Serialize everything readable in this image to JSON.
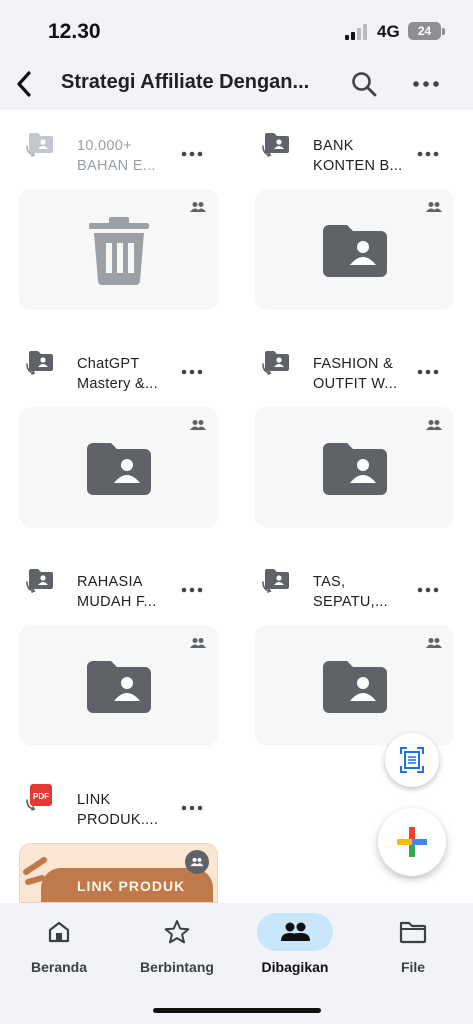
{
  "status_bar": {
    "time": "12.30",
    "network": "4G",
    "battery": "24"
  },
  "header": {
    "title": "Strategi Affiliate Dengan...",
    "back_icon": "chevron-left-icon",
    "search_icon": "search-icon",
    "more_icon": "more-horiz-icon"
  },
  "folders": [
    {
      "line1": "10.000+",
      "line2": "BAHAN E...",
      "dimmed": true,
      "thumbnail": "trash-icon"
    },
    {
      "line1": "BANK",
      "line2": "KONTEN B...",
      "dimmed": false,
      "thumbnail": "shared-folder-icon"
    },
    {
      "line1": "ChatGPT",
      "line2": "Mastery &...",
      "dimmed": false,
      "thumbnail": "shared-folder-icon"
    },
    {
      "line1": "FASHION &",
      "line2": "OUTFIT W...",
      "dimmed": false,
      "thumbnail": "shared-folder-icon"
    },
    {
      "line1": "RAHASIA",
      "line2": "MUDAH F...",
      "dimmed": false,
      "thumbnail": "shared-folder-icon"
    },
    {
      "line1": "TAS,",
      "line2": "SEPATU,...",
      "dimmed": false,
      "thumbnail": "shared-folder-icon"
    }
  ],
  "files": [
    {
      "line1": "LINK",
      "line2": "PRODUK....",
      "type_icon": "pdf-icon",
      "type_label": "PDF",
      "thumbnail_text": "LINK PRODUK"
    }
  ],
  "fabs": {
    "scan_icon": "document-scan-icon",
    "new_icon": "plus-icon"
  },
  "bottom_nav": [
    {
      "label": "Beranda",
      "icon": "home-icon",
      "active": false
    },
    {
      "label": "Berbintang",
      "icon": "star-icon",
      "active": false
    },
    {
      "label": "Dibagikan",
      "icon": "people-icon",
      "active": true
    },
    {
      "label": "File",
      "icon": "folder-icon",
      "active": false
    }
  ],
  "colors": {
    "accent": "#1a73e8",
    "active_nav_bg": "#c9e6fb",
    "folder_gray": "#5f6368",
    "bar_bg": "#f1f3f9"
  }
}
